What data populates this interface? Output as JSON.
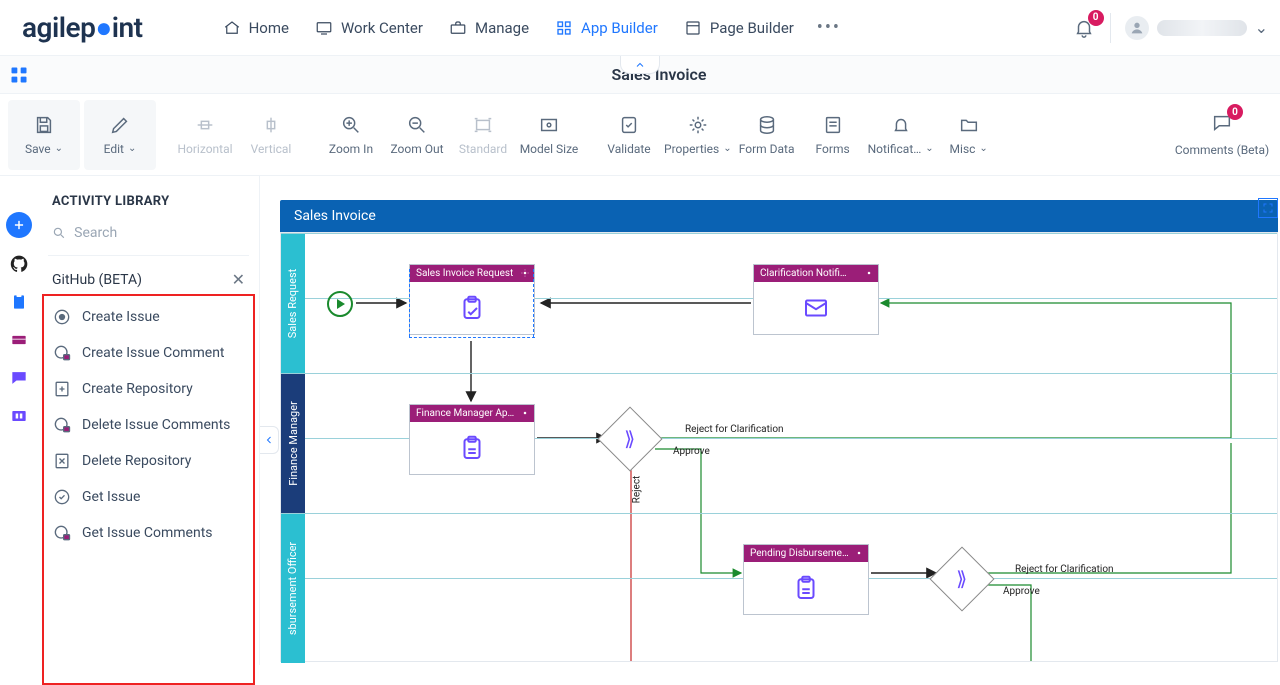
{
  "brand": {
    "name": "agilep",
    "dot": "•",
    "suffix": "int"
  },
  "nav": {
    "home": "Home",
    "work_center": "Work Center",
    "manage": "Manage",
    "app_builder": "App Builder",
    "page_builder": "Page Builder"
  },
  "notifications": {
    "count": "0"
  },
  "subheader": {
    "title": "Sales Invoice"
  },
  "toolbar": {
    "save": "Save",
    "edit": "Edit",
    "horizontal": "Horizontal",
    "vertical": "Vertical",
    "zoom_in": "Zoom In",
    "zoom_out": "Zoom Out",
    "standard": "Standard",
    "model_size": "Model Size",
    "validate": "Validate",
    "properties": "Properties",
    "form_data": "Form Data",
    "forms": "Forms",
    "notifications": "Notificat…",
    "misc": "Misc",
    "comments": "Comments (Beta)",
    "comments_badge": "0"
  },
  "library": {
    "title": "ACTIVITY LIBRARY",
    "search_placeholder": "Search",
    "group": "GitHub (BETA)",
    "items": [
      "Create Issue",
      "Create Issue Comment",
      "Create Repository",
      "Delete Issue Comments",
      "Delete Repository",
      "Get Issue",
      "Get Issue Comments"
    ]
  },
  "process": {
    "title": "Sales Invoice",
    "lanes": {
      "l1": "Sales Request",
      "l2": "Finance Manager",
      "l3": "sbursement Officer"
    },
    "acts": {
      "a1": "Sales Invoice Request",
      "a2": "Clarification Notifi…",
      "a3": "Finance Manager Appr…",
      "a4": "Pending Disbursement"
    },
    "labels": {
      "reject_clar": "Reject for Clarification",
      "approve": "Approve",
      "reject": "Reject"
    }
  }
}
